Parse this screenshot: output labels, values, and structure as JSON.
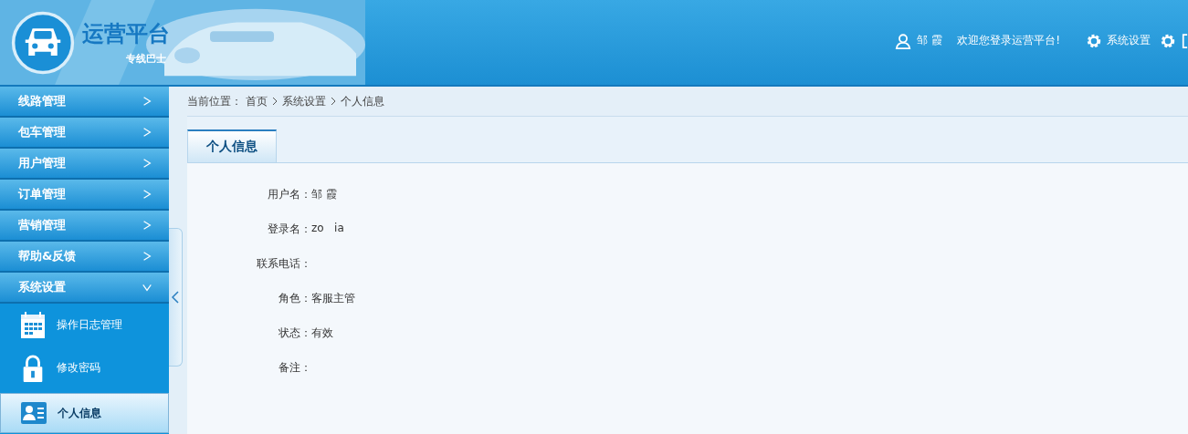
{
  "header": {
    "logo_title": "运营平台",
    "logo_subtitle": "专线巴士",
    "user_name": "邹 霞",
    "welcome": "欢迎您登录运营平台!",
    "settings_link": "系统设置"
  },
  "sidebar": {
    "items": [
      {
        "label": "线路管理",
        "expanded": false
      },
      {
        "label": "包车管理",
        "expanded": false
      },
      {
        "label": "用户管理",
        "expanded": false
      },
      {
        "label": "订单管理",
        "expanded": false
      },
      {
        "label": "营销管理",
        "expanded": false
      },
      {
        "label": "帮助&反馈",
        "expanded": false
      },
      {
        "label": "系统设置",
        "expanded": true,
        "children": [
          {
            "label": "操作日志管理",
            "selected": false
          },
          {
            "label": "修改密码",
            "selected": false
          },
          {
            "label": "个人信息",
            "selected": true
          }
        ]
      }
    ]
  },
  "breadcrumb": {
    "label": "当前位置：",
    "items": [
      "首页",
      "系统设置",
      "个人信息"
    ]
  },
  "tabs": [
    {
      "label": "个人信息",
      "selected": true
    }
  ],
  "fields": [
    {
      "label": "用户名：",
      "value": "邹 霞"
    },
    {
      "label": "登录名：",
      "value": "zo   ia"
    },
    {
      "label": "联系电话："
    },
    {
      "label": "角色：",
      "value": "客服主管"
    },
    {
      "label": "状态：",
      "value": "有效"
    },
    {
      "label": "备注："
    }
  ]
}
